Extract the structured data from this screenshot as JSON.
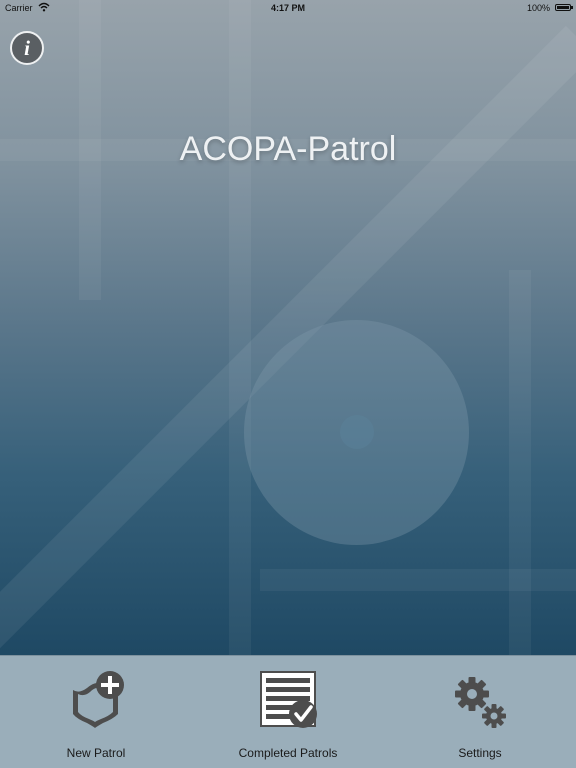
{
  "status_bar": {
    "carrier": "Carrier",
    "time": "4:17 PM",
    "battery": "100%"
  },
  "info_button": {
    "glyph": "i",
    "icon": "info-icon"
  },
  "title": "ACOPA-Patrol",
  "tabs": [
    {
      "label": "New Patrol",
      "icon": "badge-plus-icon"
    },
    {
      "label": "Completed Patrols",
      "icon": "report-check-icon"
    },
    {
      "label": "Settings",
      "icon": "gears-icon"
    }
  ],
  "colors": {
    "icon": "#4d4d4d",
    "tab_bar": "#9aaeba",
    "title": "#eef1f3"
  }
}
